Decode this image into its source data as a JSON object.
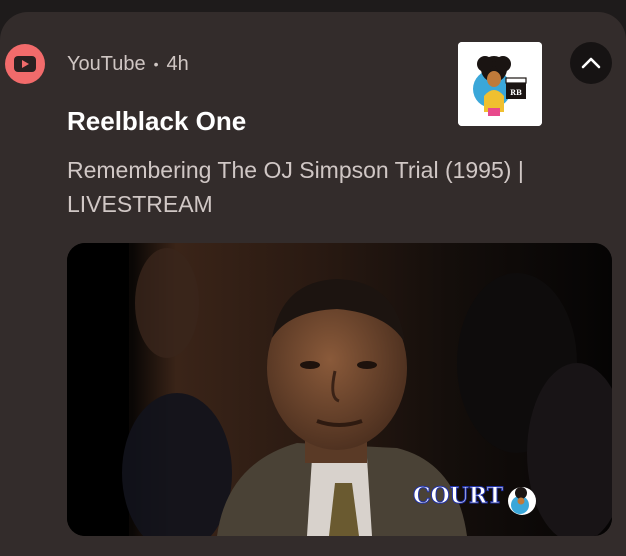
{
  "notification": {
    "app_name": "YouTube",
    "separator": "•",
    "time": "4h",
    "channel": "Reelblack One",
    "text": "Remembering The OJ Simpson Trial (1995) | LIVESTREAM",
    "app_icon": "youtube-play-icon",
    "collapse_icon": "chevron-up-icon"
  },
  "media": {
    "caption": "COURT",
    "thumbnail_badge": "RB"
  },
  "colors": {
    "card_bg": "#332c2b",
    "app_icon_bg": "#f26b6b"
  }
}
